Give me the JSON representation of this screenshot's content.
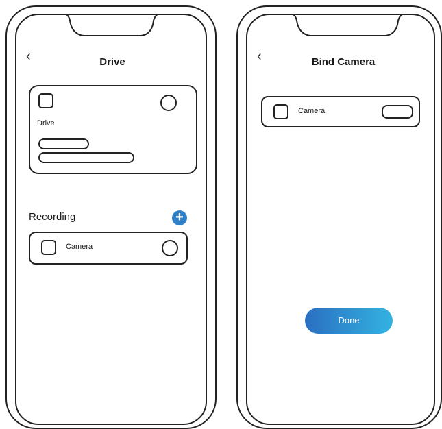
{
  "screen_drive": {
    "back_icon": "chevron-left-icon",
    "title": "Drive",
    "drive_card": {
      "label": "Drive"
    },
    "recording": {
      "heading": "Recording",
      "add_icon": "plus-circle-icon",
      "items": [
        {
          "label": "Camera"
        }
      ]
    }
  },
  "screen_bind": {
    "back_icon": "chevron-left-icon",
    "title": "Bind Camera",
    "camera_item": {
      "label": "Camera"
    },
    "done_label": "Done"
  },
  "colors": {
    "accent_start": "#2a6fc2",
    "accent_end": "#33b3e0",
    "outline": "#222222"
  }
}
